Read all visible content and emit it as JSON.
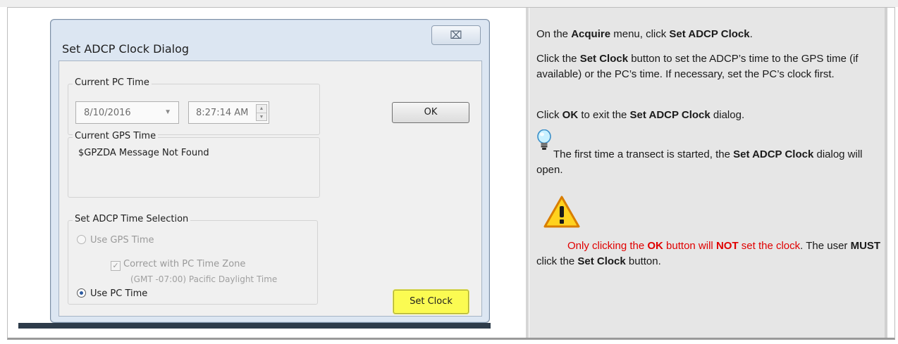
{
  "dialog": {
    "title": "Set ADCP Clock Dialog",
    "close_glyph": "⌧",
    "current_pc_time": {
      "label": "Current PC Time",
      "date": "8/10/2016",
      "time": "8:27:14 AM"
    },
    "current_gps_time": {
      "label": "Current GPS Time",
      "message": "$GPZDA Message Not Found"
    },
    "time_selection": {
      "label": "Set ADCP Time Selection",
      "use_gps_label": "Use GPS Time",
      "use_gps_selected": false,
      "correct_tz_label": "Correct with PC Time Zone",
      "correct_tz_checked": true,
      "timezone_text": "(GMT -07:00) Pacific Daylight Time",
      "use_pc_label": "Use PC Time",
      "use_pc_selected": true
    },
    "ok_label": "OK",
    "set_clock_label": "Set Clock"
  },
  "instructions": {
    "p1": {
      "a": "On the ",
      "b": "Acquire",
      "c": " menu, click ",
      "d": "Set ADCP Clock",
      "e": "."
    },
    "p2": {
      "a": "Click the ",
      "b": "Set Clock",
      "c": " button to set the ADCP’s time to the GPS time (if available) or the PC’s time. If necessary, set the PC’s clock first."
    },
    "p3": {
      "a": "Click ",
      "b": "OK",
      "c": " to exit the ",
      "d": "Set ADCP Clock",
      "e": " dialog."
    },
    "tip": {
      "a": "The first time a transect is started, the ",
      "b": "Set ADCP Clock",
      "c": " dialog will open."
    },
    "warning": {
      "a": "Only clicking the ",
      "b": "OK",
      "c": " button will ",
      "d": "NOT",
      "e": " set the clock",
      "f": ". The user ",
      "g": "MUST",
      "h": " click the ",
      "i": "Set Clock",
      "j": " button."
    }
  },
  "colors": {
    "warning_red": "#e00000",
    "set_clock_highlight": "#fbfb52"
  },
  "icons": {
    "tip": "lightbulb-icon",
    "warning": "warning-icon"
  }
}
